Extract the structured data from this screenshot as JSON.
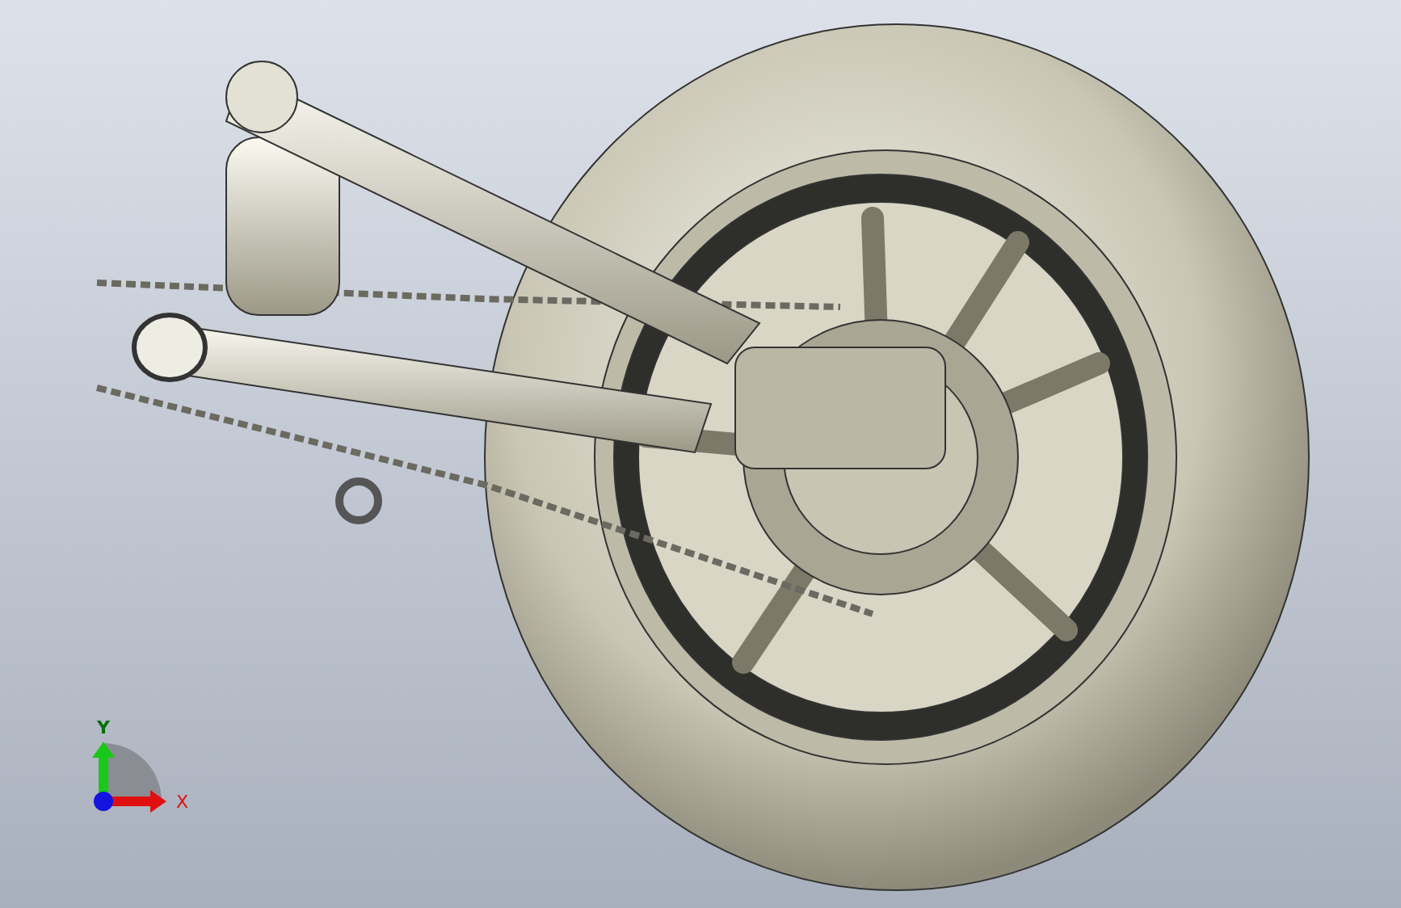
{
  "viewport": {
    "triad": {
      "axes": [
        {
          "kind": "vertical",
          "label": "Y",
          "color": "#19c919"
        },
        {
          "kind": "horizontal",
          "label": "X",
          "color": "#e01010"
        }
      ]
    }
  }
}
